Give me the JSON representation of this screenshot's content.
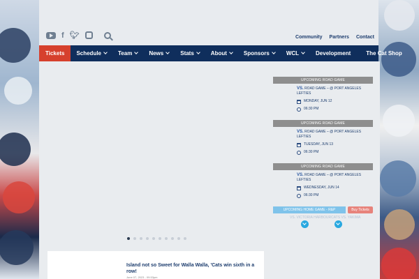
{
  "social": {
    "icons": [
      "youtube-icon",
      "facebook-icon",
      "twitter-icon",
      "instagram-icon",
      "search-icon"
    ]
  },
  "toplinks": [
    "Community",
    "Partners",
    "Contact"
  ],
  "nav": {
    "tickets": "Tickets",
    "items": [
      {
        "label": "Schedule",
        "dropdown": true
      },
      {
        "label": "Team",
        "dropdown": true
      },
      {
        "label": "News",
        "dropdown": true
      },
      {
        "label": "Stats",
        "dropdown": true
      },
      {
        "label": "About",
        "dropdown": true
      },
      {
        "label": "Sponsors",
        "dropdown": true
      },
      {
        "label": "WCL",
        "dropdown": true
      },
      {
        "label": "Development",
        "dropdown": false
      },
      {
        "label": "The Cat Shop",
        "dropdown": false
      }
    ]
  },
  "slider": {
    "dot_count": 10,
    "active_dot": 1
  },
  "games": [
    {
      "header": "UPCOMING ROAD GAME",
      "vs": "VS.",
      "opponent": "ROAD GAME – @ PORT ANGELES LEFTIES",
      "date": "MONDAY, JUN 12",
      "time": "06:30 PM"
    },
    {
      "header": "UPCOMING ROAD GAME",
      "vs": "VS.",
      "opponent": "ROAD GAME – @ PORT ANGELES LEFTIES",
      "date": "TUESDAY, JUN 13",
      "time": "06:30 PM"
    },
    {
      "header": "UPCOMING ROAD GAME",
      "vs": "VS.",
      "opponent": "ROAD GAME – @ PORT ANGELES LEFTIES",
      "date": "WEDNESDAY, JUN 14",
      "time": "06:30 PM"
    }
  ],
  "home_game": {
    "header": "UPCOMING HOME GAME - R&P",
    "buy": "Buy Tickets",
    "text": "VS. VICTORIA HARBOURCATS VS. YAKIMA"
  },
  "news": {
    "title": "Island not so Sweet for Walla Walla, 'Cats win sixth in a row!",
    "date": "June 07, 2023 - 09:53pm"
  },
  "colors": {
    "nav_bg": "#0f2e5c",
    "tickets_bg": "#d6402d",
    "road_header": "#8e8e8e",
    "home_header": "#7fc3ea",
    "buy_button": "#e7837b"
  }
}
